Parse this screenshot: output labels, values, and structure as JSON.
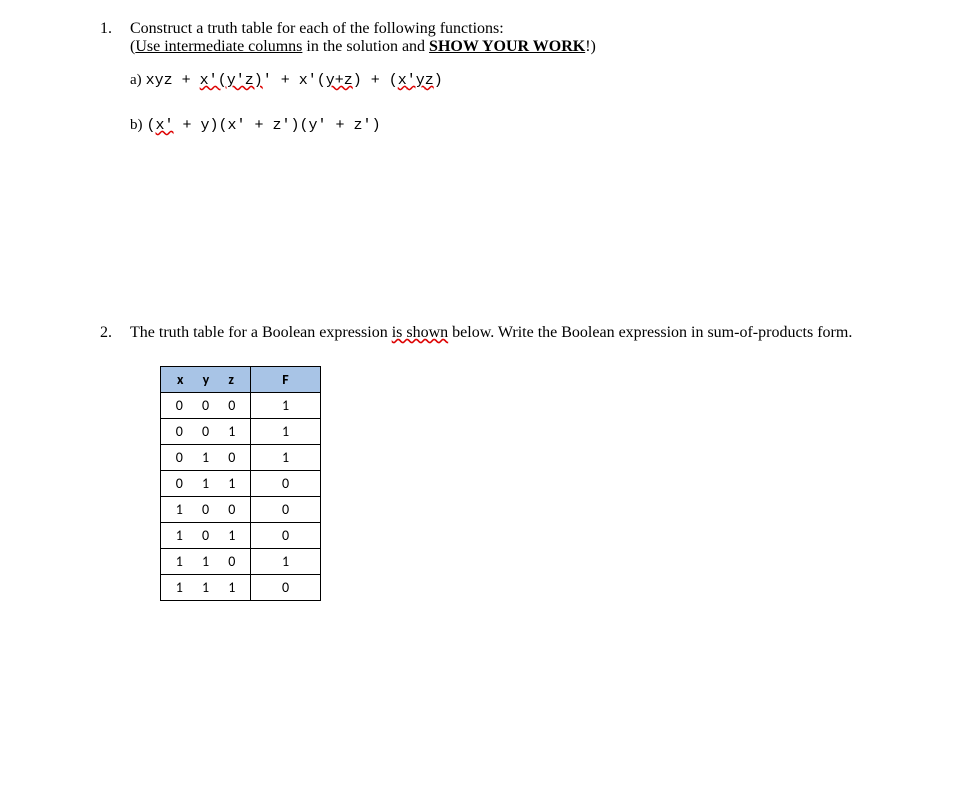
{
  "q1": {
    "number": "1.",
    "prompt_line1": "Construct a truth table for each of the following functions:",
    "prompt_line2_prefix": "(",
    "prompt_line2_underlined": "Use intermediate columns",
    "prompt_line2_mid": " in the solution and ",
    "prompt_line2_bold": "SHOW YOUR WORK",
    "prompt_line2_suffix": "!)",
    "parts": {
      "a": {
        "label": "a) ",
        "seg1": "xyz + ",
        "seg2_wavy": "x'",
        "seg3_wavy": "(y'z)",
        "seg4": "' + x'(",
        "seg5_wavy": "y+z",
        "seg6": ") + (",
        "seg7_wavy": "x'yz",
        "seg8": ")"
      },
      "b": {
        "label": "b) ",
        "seg1": "(",
        "seg2_wavy": "x'",
        "seg3": " + y)(x' + z')(y' + z')"
      }
    }
  },
  "q2": {
    "number": "2.",
    "prompt_part1": "The truth table for a Boolean expression ",
    "prompt_wavy": "is shown",
    "prompt_part2": " below. Write the Boolean expression in sum-of-products form.",
    "table": {
      "header_xyz": "x  y  z",
      "header_f": "F",
      "rows": [
        {
          "xyz": "0 0 0",
          "f": "1"
        },
        {
          "xyz": "0 0 1",
          "f": "1"
        },
        {
          "xyz": "0 1 0",
          "f": "1"
        },
        {
          "xyz": "0 1 1",
          "f": "0"
        },
        {
          "xyz": "1 0 0",
          "f": "0"
        },
        {
          "xyz": "1 0 1",
          "f": "0"
        },
        {
          "xyz": "1 1 0",
          "f": "1"
        },
        {
          "xyz": "1 1 1",
          "f": "0"
        }
      ]
    }
  }
}
